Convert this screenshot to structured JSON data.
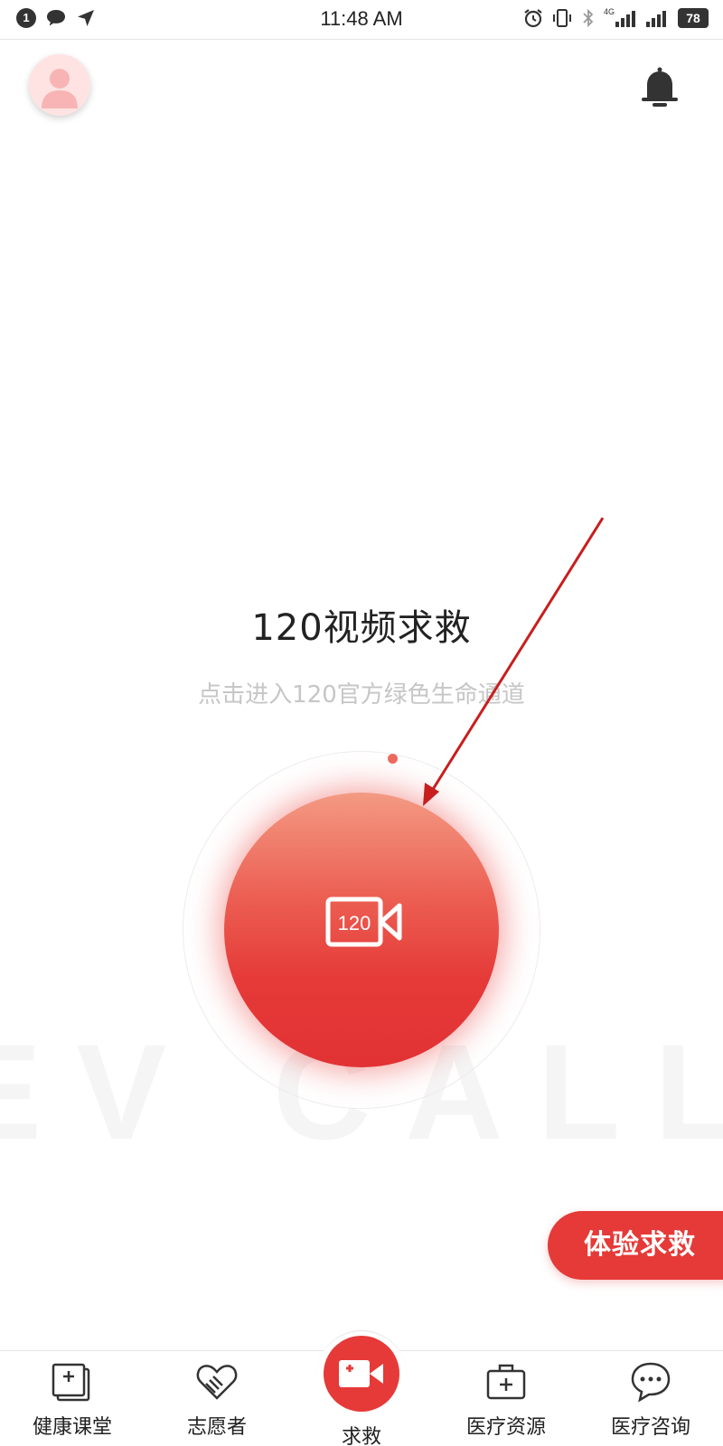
{
  "status_bar": {
    "notification_count": "1",
    "time": "11:48 AM",
    "network_label": "4G",
    "battery": "78"
  },
  "main": {
    "title": "120视频求救",
    "subtitle": "点击进入120官方绿色生命通道",
    "sos_icon_text": "120",
    "watermark_text": "EV CALL",
    "trial_button_label": "体验求救"
  },
  "bottom_nav": {
    "items": [
      {
        "label": "健康课堂",
        "icon": "health-class-icon"
      },
      {
        "label": "志愿者",
        "icon": "volunteer-heart-icon"
      },
      {
        "label": "求救",
        "icon": "video-call-icon"
      },
      {
        "label": "医疗资源",
        "icon": "first-aid-kit-icon"
      },
      {
        "label": "医疗咨询",
        "icon": "chat-bubble-icon"
      }
    ]
  },
  "colors": {
    "accent": "#e53a38",
    "accent_light": "#f39a83",
    "subtitle": "#c6c6c6"
  }
}
